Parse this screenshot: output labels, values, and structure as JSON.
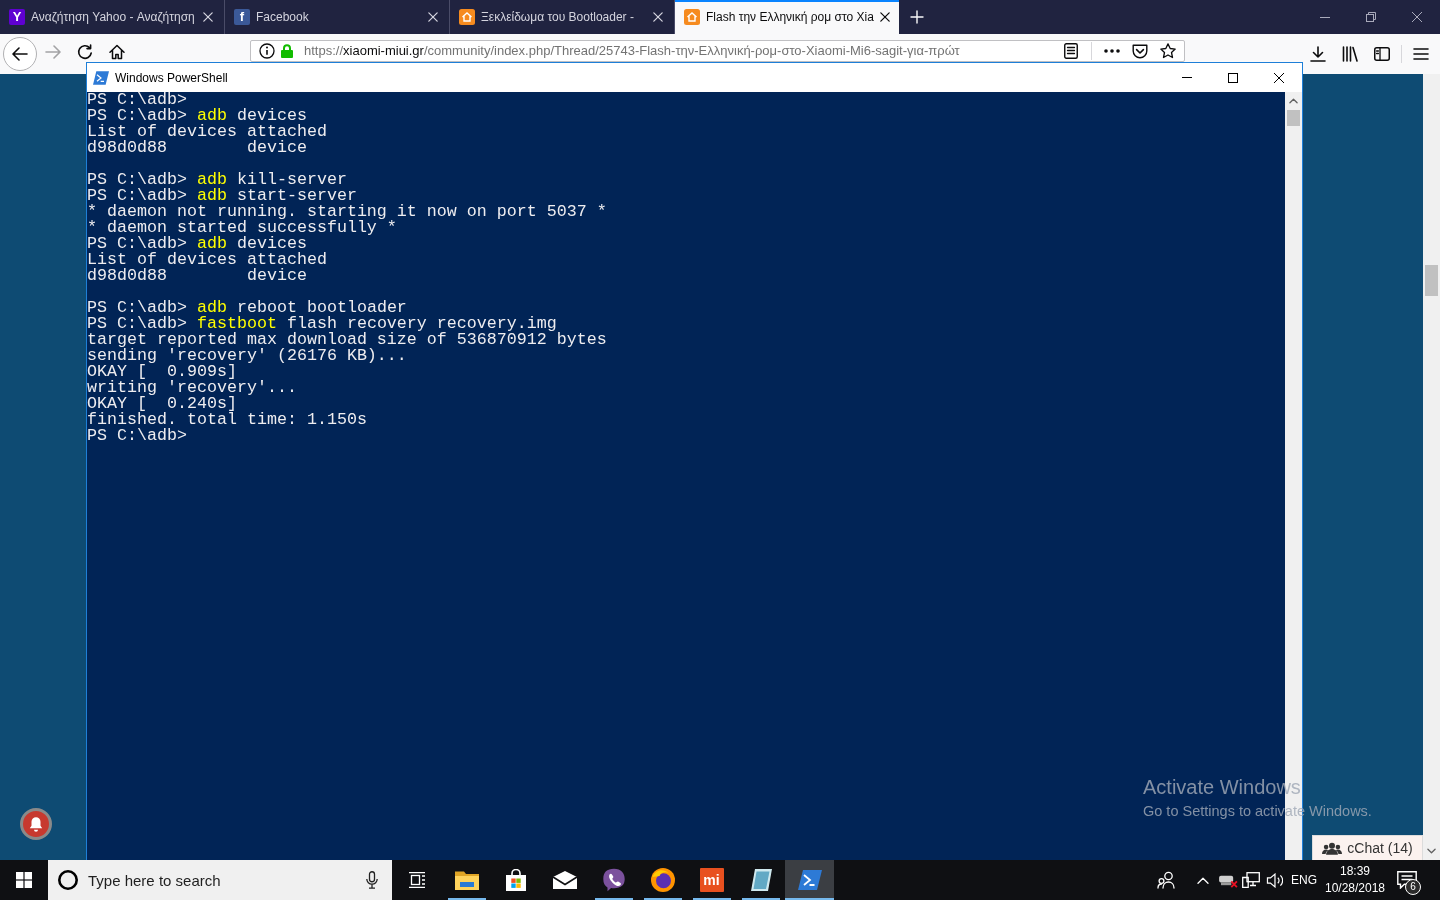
{
  "browser": {
    "tabs": [
      {
        "title": "Αναζήτηση Yahoo - Αναζήτηση",
        "selected": false,
        "favicon": {
          "kind": "letter",
          "text": "Y",
          "color": "#5f01d1"
        }
      },
      {
        "title": "Facebook",
        "selected": false,
        "favicon": {
          "kind": "letter",
          "text": "f",
          "color": "#3b5998"
        }
      },
      {
        "title": "Ξεκλείδωμα του Bootloader -",
        "selected": false,
        "favicon": {
          "kind": "house",
          "color": "#f68b1f"
        }
      },
      {
        "title": "Flash την Ελληνική ρομ στο Xia",
        "selected": true,
        "favicon": {
          "kind": "house",
          "color": "#f68b1f"
        }
      }
    ],
    "toolbar": {
      "back": {
        "disabled": false
      },
      "forward": {
        "disabled": true
      }
    },
    "address_bar": {
      "scheme": "https://",
      "host": "xiaomi-miui.gr",
      "path": "/community/index.php/Thread/25743-Flash-την-Ελληνική-ρομ-στο-Xiaomi-Mi6-sagit-για-πρώτ"
    }
  },
  "powershell_window": {
    "title": "Windows PowerShell",
    "lines": [
      {
        "kind": "output",
        "segments": [
          {
            "kind": "text",
            "text": "PS C:\\adb>"
          }
        ]
      },
      {
        "kind": "output",
        "segments": [
          {
            "kind": "text",
            "text": "PS C:\\adb> "
          },
          {
            "kind": "command",
            "text": "adb"
          },
          {
            "kind": "text",
            "text": " devices"
          }
        ]
      },
      {
        "kind": "output",
        "segments": [
          {
            "kind": "text",
            "text": "List of devices attached"
          }
        ]
      },
      {
        "kind": "output",
        "segments": [
          {
            "kind": "text",
            "text": "d98d0d88        device"
          }
        ]
      },
      {
        "kind": "blank"
      },
      {
        "kind": "output",
        "segments": [
          {
            "kind": "text",
            "text": "PS C:\\adb> "
          },
          {
            "kind": "command",
            "text": "adb"
          },
          {
            "kind": "text",
            "text": " kill-server"
          }
        ]
      },
      {
        "kind": "output",
        "segments": [
          {
            "kind": "text",
            "text": "PS C:\\adb> "
          },
          {
            "kind": "command",
            "text": "adb"
          },
          {
            "kind": "text",
            "text": " start-server"
          }
        ]
      },
      {
        "kind": "output",
        "segments": [
          {
            "kind": "text",
            "text": "* daemon not running. starting it now on port 5037 *"
          }
        ]
      },
      {
        "kind": "output",
        "segments": [
          {
            "kind": "text",
            "text": "* daemon started successfully *"
          }
        ]
      },
      {
        "kind": "output",
        "segments": [
          {
            "kind": "text",
            "text": "PS C:\\adb> "
          },
          {
            "kind": "command",
            "text": "adb"
          },
          {
            "kind": "text",
            "text": " devices"
          }
        ]
      },
      {
        "kind": "output",
        "segments": [
          {
            "kind": "text",
            "text": "List of devices attached"
          }
        ]
      },
      {
        "kind": "output",
        "segments": [
          {
            "kind": "text",
            "text": "d98d0d88        device"
          }
        ]
      },
      {
        "kind": "blank"
      },
      {
        "kind": "output",
        "segments": [
          {
            "kind": "text",
            "text": "PS C:\\adb> "
          },
          {
            "kind": "command",
            "text": "adb"
          },
          {
            "kind": "text",
            "text": " reboot bootloader"
          }
        ]
      },
      {
        "kind": "output",
        "segments": [
          {
            "kind": "text",
            "text": "PS C:\\adb> "
          },
          {
            "kind": "command",
            "text": "fastboot"
          },
          {
            "kind": "text",
            "text": " flash recovery recovery.img"
          }
        ]
      },
      {
        "kind": "output",
        "segments": [
          {
            "kind": "text",
            "text": "target reported max download size of 536870912 bytes"
          }
        ]
      },
      {
        "kind": "output",
        "segments": [
          {
            "kind": "text",
            "text": "sending 'recovery' (26176 KB)..."
          }
        ]
      },
      {
        "kind": "output",
        "segments": [
          {
            "kind": "text",
            "text": "OKAY [  0.909s]"
          }
        ]
      },
      {
        "kind": "output",
        "segments": [
          {
            "kind": "text",
            "text": "writing 'recovery'..."
          }
        ]
      },
      {
        "kind": "output",
        "segments": [
          {
            "kind": "text",
            "text": "OKAY [  0.240s]"
          }
        ]
      },
      {
        "kind": "output",
        "segments": [
          {
            "kind": "text",
            "text": "finished. total time: 1.150s"
          }
        ]
      },
      {
        "kind": "output",
        "segments": [
          {
            "kind": "text",
            "text": "PS C:\\adb>"
          }
        ]
      }
    ]
  },
  "web_page": {
    "chat_button": {
      "label": "cChat (14)"
    }
  },
  "activation_notice": {
    "title": "Activate Windows",
    "message": "Go to Settings to activate Windows."
  },
  "taskbar": {
    "search": {
      "placeholder": "Type here to search"
    },
    "apps": [
      {
        "kind": "folder",
        "running": true,
        "selected": false
      },
      {
        "kind": "bag",
        "running": false,
        "selected": false
      },
      {
        "kind": "envelope",
        "running": false,
        "selected": false
      },
      {
        "kind": "phone-bubble",
        "running": true,
        "selected": false
      },
      {
        "kind": "globe",
        "running": true,
        "selected": false
      },
      {
        "kind": "letter-tile",
        "text": "mi",
        "color": "#e8501f",
        "running": true,
        "selected": false
      },
      {
        "kind": "notebook",
        "running": true,
        "selected": false
      },
      {
        "kind": "terminal",
        "running": true,
        "selected": true
      }
    ],
    "language": "ENG",
    "time": "18:39",
    "date": "10/28/2018",
    "notification_count": "6"
  }
}
